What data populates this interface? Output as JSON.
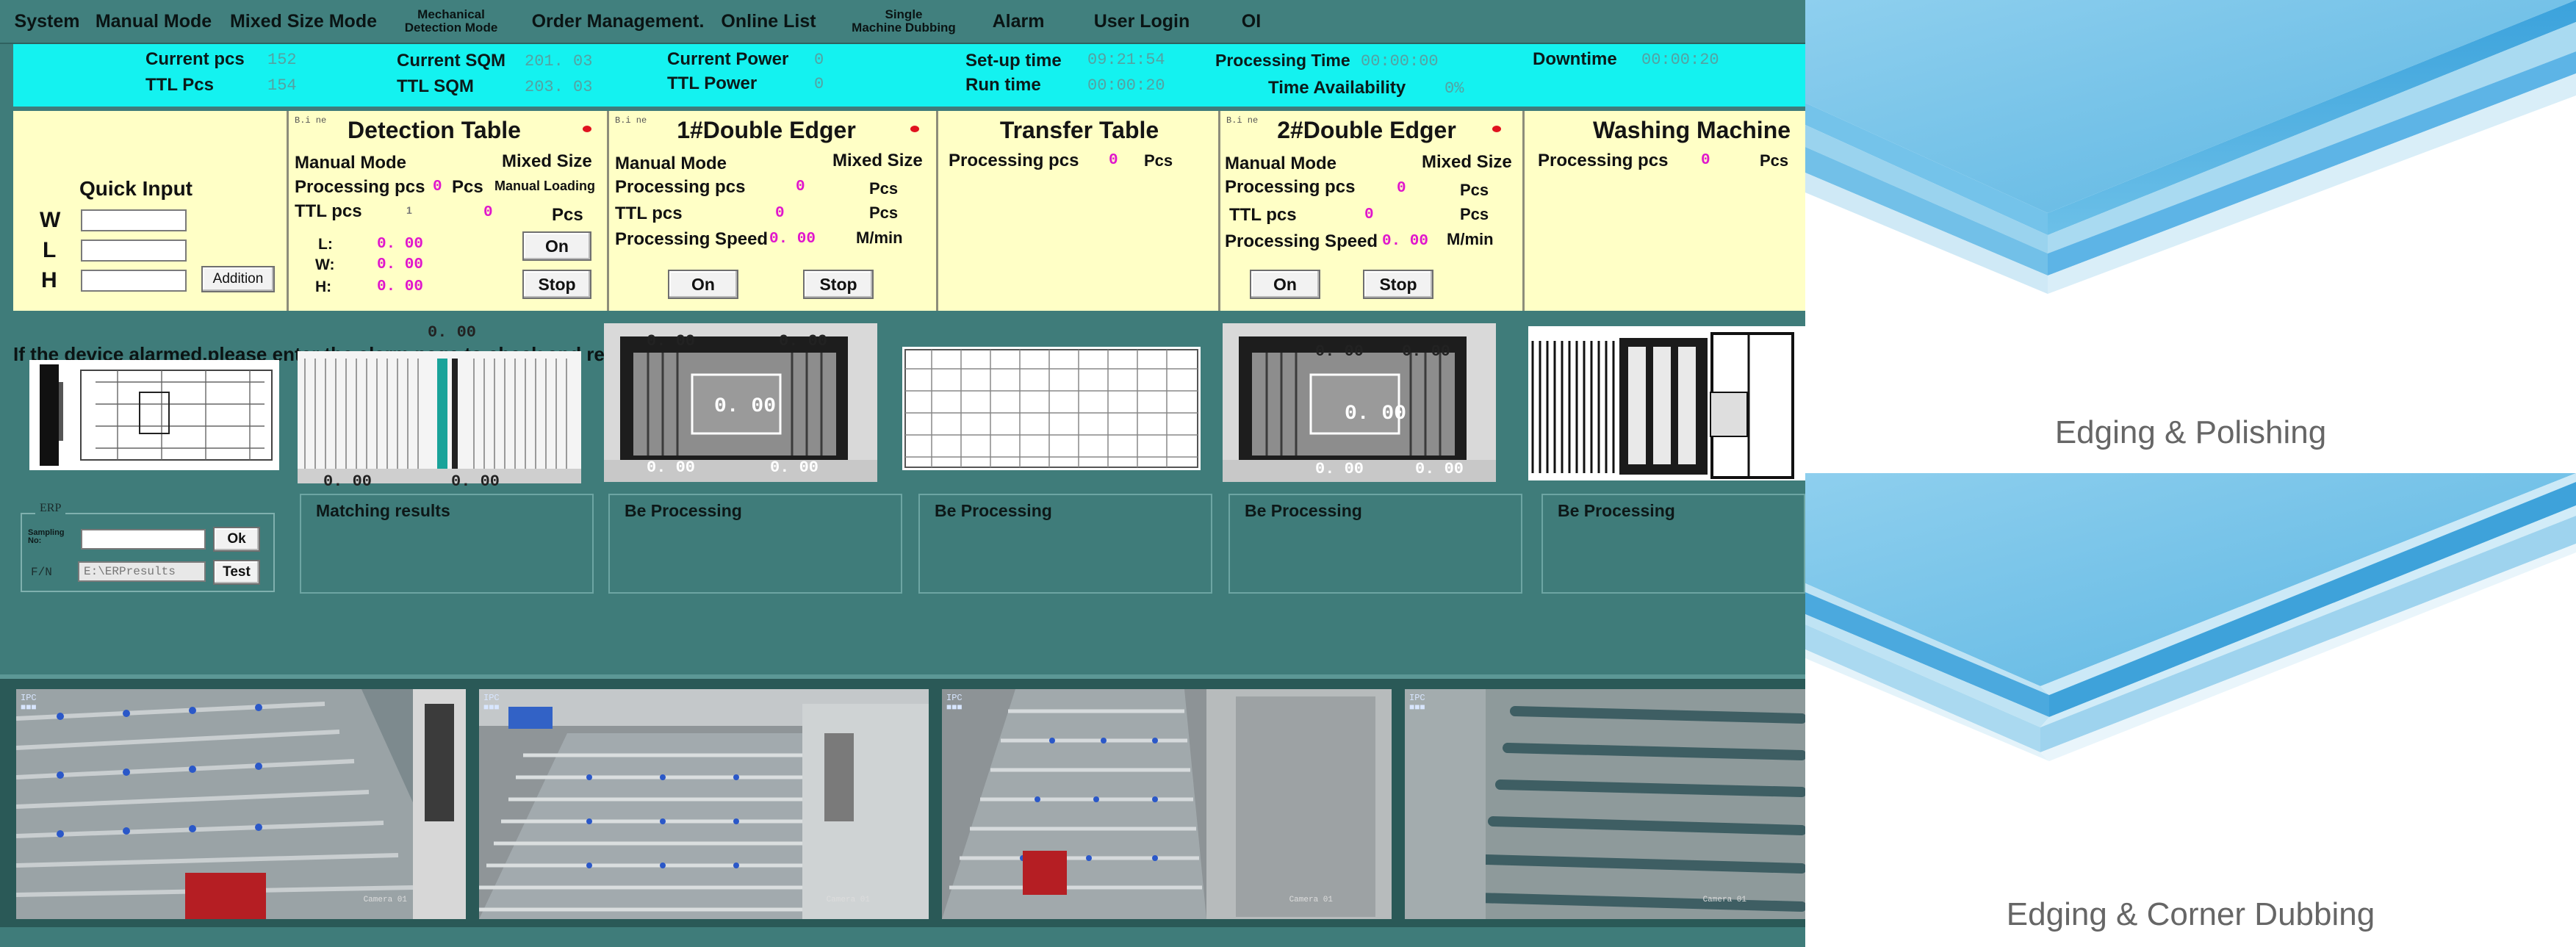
{
  "menu": [
    "System",
    "Manual Mode",
    "Mixed Size Mode",
    "Mechanical\nDetection Mode",
    "Order Management.",
    "Online List",
    "Single\nMachine Dubbing",
    "Alarm",
    "User Login",
    "OI"
  ],
  "status": {
    "current_pcs_label": "Current pcs",
    "current_pcs": "152",
    "ttl_pcs_label": "TTL Pcs",
    "ttl_pcs": "154",
    "current_sqm_label": "Current SQM",
    "current_sqm": "201. 03",
    "ttl_sqm_label": "TTL SQM",
    "ttl_sqm": "203. 03",
    "current_power_label": "Current Power",
    "current_power": "0",
    "ttl_power_label": "TTL Power",
    "ttl_power": "0",
    "setup_time_label": "Set-up time",
    "setup_time": "09:21:54",
    "run_time_label": "Run time",
    "run_time": "00:00:20",
    "processing_time_label": "Processing Time",
    "processing_time": "00:00:00",
    "time_availability_label": "Time Availability",
    "time_availability": "0%",
    "downtime_label": "Downtime",
    "downtime": "00:00:20"
  },
  "quick_input": {
    "title": "Quick Input",
    "w": "W",
    "l": "L",
    "h": "H",
    "addition_button": "Addition"
  },
  "detection_table": {
    "title": "Detection Table",
    "mode": "Manual Mode",
    "mixed": "Mixed Size",
    "processing_label": "Processing pcs",
    "processing_value": "0",
    "pcs": "Pcs",
    "manual_loading": "Manual Loading",
    "ttl_label": "TTL pcs",
    "ttl_value": "0",
    "ttl_small": "1",
    "l_label": "L:",
    "w_label": "W:",
    "h_label": "H:",
    "l_value": "0. 00",
    "w_value": "0. 00",
    "h_value": "0. 00",
    "on_button": "On",
    "stop_button": "Stop"
  },
  "edger1": {
    "title": "1#Double Edger",
    "mode": "Manual Mode",
    "mixed": "Mixed Size",
    "processing_label": "Processing pcs",
    "processing_value": "0",
    "pcs1": "Pcs",
    "ttl_label": "TTL pcs",
    "ttl_value": "0",
    "pcs2": "Pcs",
    "speed_label": "Processing Speed",
    "speed_value": "0. 00",
    "speed_unit": "M/min",
    "on_button": "On",
    "stop_button": "Stop"
  },
  "transfer": {
    "title": "Transfer Table",
    "processing_label": "Processing pcs",
    "processing_value": "0",
    "pcs": "Pcs"
  },
  "edger2": {
    "title": "2#Double Edger",
    "mode": "Manual Mode",
    "mixed": "Mixed Size",
    "processing_label": "Processing pcs",
    "processing_value": "0",
    "pcs1": "Pcs",
    "ttl_label": "TTL pcs",
    "ttl_value": "0",
    "pcs2": "Pcs",
    "speed_label": "Processing Speed",
    "speed_value": "0. 00",
    "speed_unit": "M/min",
    "on_button": "On",
    "stop_button": "Stop"
  },
  "washing": {
    "title": "Washing Machine",
    "processing_label": "Processing pcs",
    "processing_value": "0",
    "pcs": "Pcs"
  },
  "alarm_message": "If the device alarmed,please enter the alarm page to check and remove the alarm",
  "machine_values": {
    "detect_top": "0. 00",
    "detect_bottom_l": "0. 00",
    "detect_bottom_r": "0. 00",
    "e1_top_l": "0. 00",
    "e1_top_r": "0. 00",
    "e1_center": "0. 00",
    "e1_bottom_l": "0. 00",
    "e1_bottom_r": "0. 00",
    "e2_top_l": "0. 00",
    "e2_top_r": "0. 00",
    "e2_center": "0. 00",
    "e2_bottom_l": "0. 00",
    "e2_bottom_r": "0. 00"
  },
  "erp": {
    "legend": "ERP",
    "sampling_label": "Sampling\nNo:",
    "path_label": "F/N",
    "path_value": "E:\\ERPresults",
    "ok_button": "Ok",
    "test_button": "Test"
  },
  "results": [
    "Matching results",
    "Be Processing",
    "Be Processing",
    "Be Processing",
    "Be Processing"
  ],
  "cameras": [
    {
      "osd": "IPC\n■■■",
      "label": "Camera 01"
    },
    {
      "osd": "IPC\n■■■",
      "label": "Camera 01"
    },
    {
      "osd": "IPC\n■■■",
      "label": "Camera 01"
    },
    {
      "osd": "IPC\n■■■",
      "label": "Camera 01"
    }
  ],
  "products": [
    {
      "caption": "Edging & Polishing"
    },
    {
      "caption": "Edging & Corner Dubbing"
    }
  ],
  "colors": {
    "teal": "#3f7c7a",
    "cyan": "#14f2f0",
    "panel": "#ffffc6",
    "magenta": "#e016cc",
    "glass": "#5db4e6"
  }
}
